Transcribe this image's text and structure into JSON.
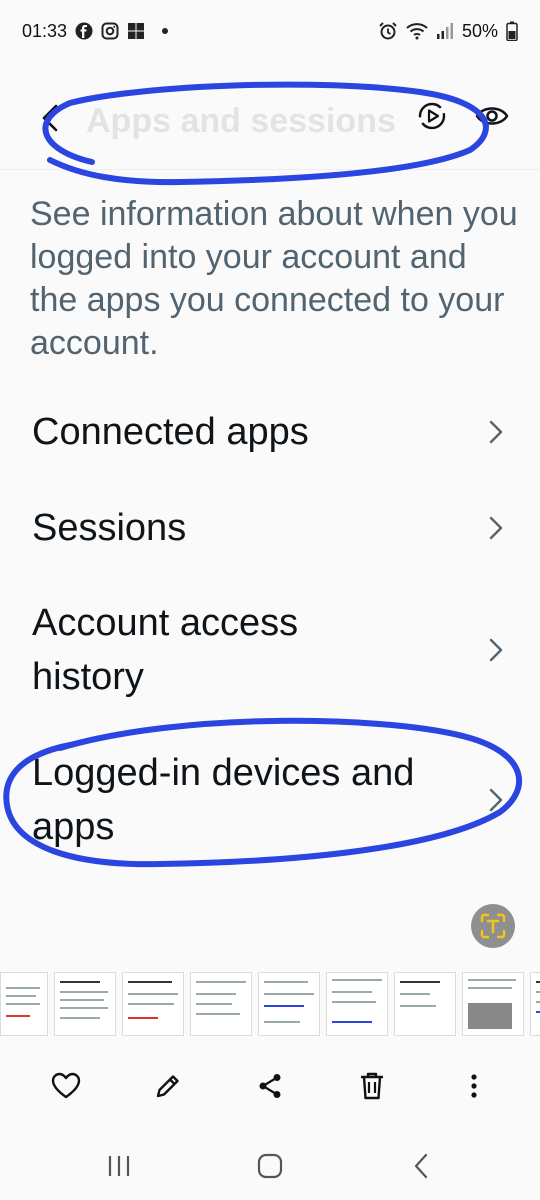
{
  "status_bar": {
    "time": "01:33",
    "battery": "50%",
    "notification_icons": [
      "facebook-icon",
      "instagram-icon",
      "microsoft-icon",
      "dot-icon"
    ],
    "system_icons": [
      "alarm-icon",
      "wifi-icon",
      "signal-icon",
      "battery-icon"
    ]
  },
  "header": {
    "title": "Apps and sessions",
    "back_icon": "back-arrow-icon",
    "actions": [
      "play-circle-icon",
      "eye-icon"
    ],
    "annotation_color": "#2b45e0"
  },
  "description": "See information about when you logged into your account and the apps you connected to your account.",
  "menu": {
    "items": [
      {
        "label": "Connected apps"
      },
      {
        "label": "Sessions"
      },
      {
        "label": "Account access history"
      },
      {
        "label": "Logged-in devices and apps"
      }
    ]
  },
  "floating_button": {
    "icon": "text-recognition-icon",
    "accent": "#f5c518"
  },
  "bottom_actions": [
    "heart-icon",
    "edit-icon",
    "share-icon",
    "delete-icon",
    "more-icon"
  ],
  "nav_bar": [
    "recents-icon",
    "home-icon",
    "back-icon"
  ]
}
